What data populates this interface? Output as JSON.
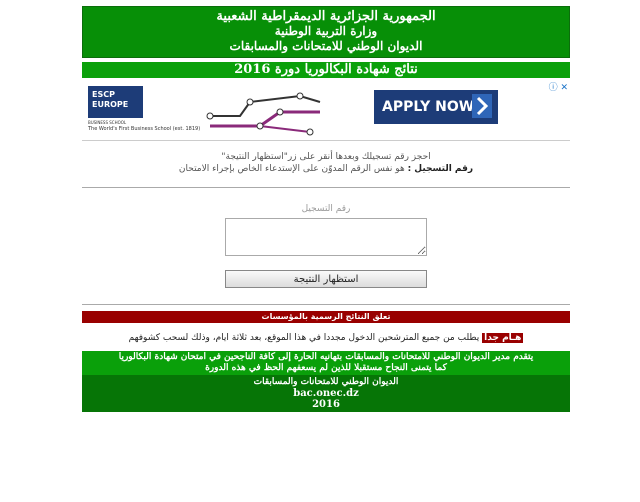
{
  "header": {
    "line1": "الجمهورية الجزائرية الديمقراطية الشعبية",
    "line2": "وزارة التربية الوطنية",
    "line3": "الديوان الوطني للامتحانات والمسابقات"
  },
  "results_title": "نتائج شهادة البكالوريا دورة 2016",
  "ad": {
    "logo_text": "ESCP EUROPE",
    "logo_sub": "BUSINESS SCHOOL",
    "tagline": "The World's First Business School (est. 1819)",
    "button_label": "APPLY NOW",
    "close_label": "✕",
    "info_label": "ⓘ"
  },
  "instructions": {
    "line1": "احجز رقم تسجيلك وبعدها أنقر على زر\"استظهار النتيجة\"",
    "line2_bold": "رقم التسجيل :",
    "line2_rest": " هو نفس الرقم المدوّن على الإستدعاء الخاص بإجراء الامتحان"
  },
  "form": {
    "label": "رقم التسجيل",
    "input_value": "",
    "submit_label": "استظهار النتيجة"
  },
  "announcement_bar": "تعلق النتائج الرسمية بالمؤسسات",
  "notice": {
    "badge": "هـام جدا",
    "text": " يطلب من جميع المترشحين الدخول مجددا في هذا الموقع، بعد ثلاثة ايام، وذلك لسحب كشوفهم"
  },
  "footer": {
    "congrats1": "يتقدم مدير الديوان الوطني للامتحانات والمسابقات بتهانيه الحارة إلى كافة الناجحين في امتحان شهادة البكالوريا",
    "congrats2": "كما يتمنى النجاح مستقبلا للذين لم يسعفهم الحظ في هذه الدورة",
    "org": "الديوان الوطني للامتحانات والمسابقات",
    "site": "bac.onec.dz",
    "year": "2016"
  },
  "colors": {
    "header_green": "#078f07",
    "bright_green": "#0aa00a",
    "dark_green": "#067506",
    "red": "#990000",
    "ad_blue": "#1d3c78"
  }
}
